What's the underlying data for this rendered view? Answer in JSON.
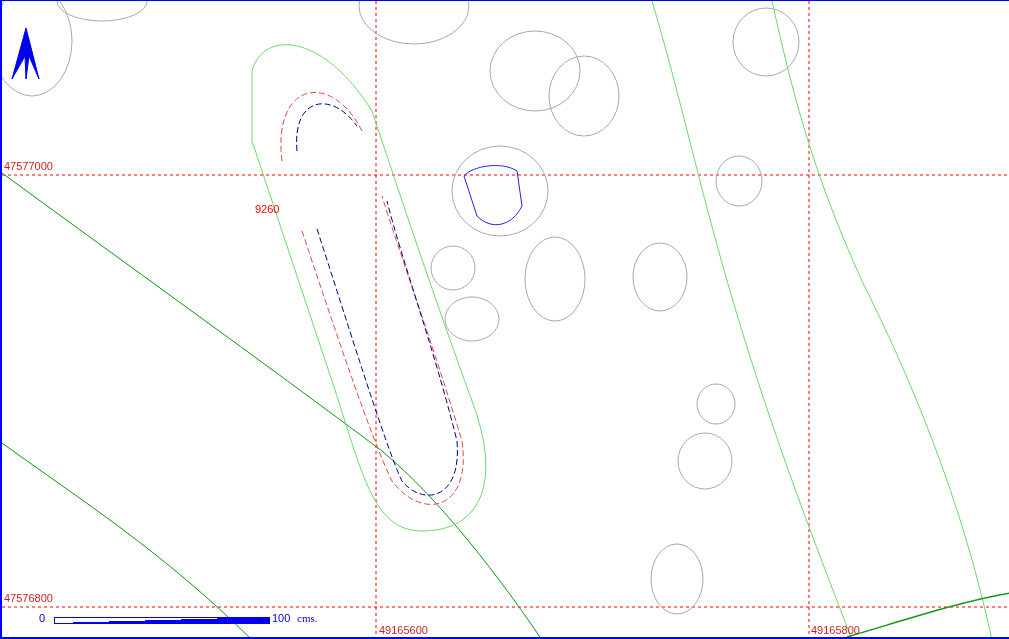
{
  "grid_labels": {
    "rows": [
      "47577000",
      "47576800"
    ],
    "columns": [
      "49165600",
      "49165800"
    ]
  },
  "feature_label": "9260",
  "scale_bar": {
    "start": "0",
    "end": "100",
    "unit": "cms."
  }
}
